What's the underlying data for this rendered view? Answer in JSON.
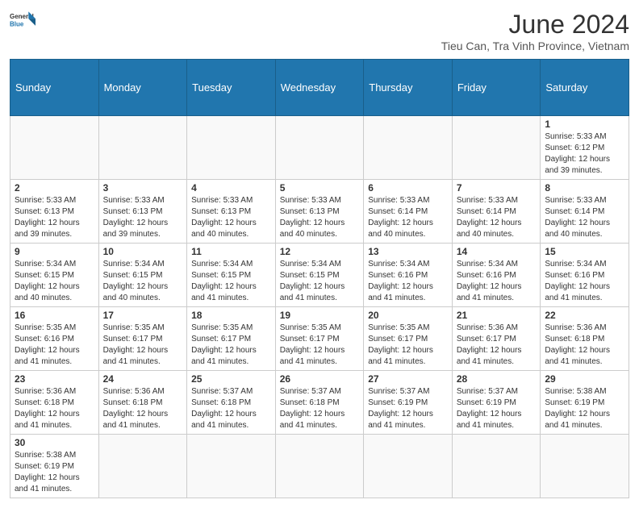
{
  "header": {
    "logo_general": "General",
    "logo_blue": "Blue",
    "month": "June 2024",
    "location": "Tieu Can, Tra Vinh Province, Vietnam"
  },
  "weekdays": [
    "Sunday",
    "Monday",
    "Tuesday",
    "Wednesday",
    "Thursday",
    "Friday",
    "Saturday"
  ],
  "weeks": [
    [
      {
        "day": "",
        "info": ""
      },
      {
        "day": "",
        "info": ""
      },
      {
        "day": "",
        "info": ""
      },
      {
        "day": "",
        "info": ""
      },
      {
        "day": "",
        "info": ""
      },
      {
        "day": "",
        "info": ""
      },
      {
        "day": "1",
        "info": "Sunrise: 5:33 AM\nSunset: 6:12 PM\nDaylight: 12 hours\nand 39 minutes."
      }
    ],
    [
      {
        "day": "2",
        "info": "Sunrise: 5:33 AM\nSunset: 6:13 PM\nDaylight: 12 hours\nand 39 minutes."
      },
      {
        "day": "3",
        "info": "Sunrise: 5:33 AM\nSunset: 6:13 PM\nDaylight: 12 hours\nand 39 minutes."
      },
      {
        "day": "4",
        "info": "Sunrise: 5:33 AM\nSunset: 6:13 PM\nDaylight: 12 hours\nand 40 minutes."
      },
      {
        "day": "5",
        "info": "Sunrise: 5:33 AM\nSunset: 6:13 PM\nDaylight: 12 hours\nand 40 minutes."
      },
      {
        "day": "6",
        "info": "Sunrise: 5:33 AM\nSunset: 6:14 PM\nDaylight: 12 hours\nand 40 minutes."
      },
      {
        "day": "7",
        "info": "Sunrise: 5:33 AM\nSunset: 6:14 PM\nDaylight: 12 hours\nand 40 minutes."
      },
      {
        "day": "8",
        "info": "Sunrise: 5:33 AM\nSunset: 6:14 PM\nDaylight: 12 hours\nand 40 minutes."
      }
    ],
    [
      {
        "day": "9",
        "info": "Sunrise: 5:34 AM\nSunset: 6:15 PM\nDaylight: 12 hours\nand 40 minutes."
      },
      {
        "day": "10",
        "info": "Sunrise: 5:34 AM\nSunset: 6:15 PM\nDaylight: 12 hours\nand 40 minutes."
      },
      {
        "day": "11",
        "info": "Sunrise: 5:34 AM\nSunset: 6:15 PM\nDaylight: 12 hours\nand 41 minutes."
      },
      {
        "day": "12",
        "info": "Sunrise: 5:34 AM\nSunset: 6:15 PM\nDaylight: 12 hours\nand 41 minutes."
      },
      {
        "day": "13",
        "info": "Sunrise: 5:34 AM\nSunset: 6:16 PM\nDaylight: 12 hours\nand 41 minutes."
      },
      {
        "day": "14",
        "info": "Sunrise: 5:34 AM\nSunset: 6:16 PM\nDaylight: 12 hours\nand 41 minutes."
      },
      {
        "day": "15",
        "info": "Sunrise: 5:34 AM\nSunset: 6:16 PM\nDaylight: 12 hours\nand 41 minutes."
      }
    ],
    [
      {
        "day": "16",
        "info": "Sunrise: 5:35 AM\nSunset: 6:16 PM\nDaylight: 12 hours\nand 41 minutes."
      },
      {
        "day": "17",
        "info": "Sunrise: 5:35 AM\nSunset: 6:17 PM\nDaylight: 12 hours\nand 41 minutes."
      },
      {
        "day": "18",
        "info": "Sunrise: 5:35 AM\nSunset: 6:17 PM\nDaylight: 12 hours\nand 41 minutes."
      },
      {
        "day": "19",
        "info": "Sunrise: 5:35 AM\nSunset: 6:17 PM\nDaylight: 12 hours\nand 41 minutes."
      },
      {
        "day": "20",
        "info": "Sunrise: 5:35 AM\nSunset: 6:17 PM\nDaylight: 12 hours\nand 41 minutes."
      },
      {
        "day": "21",
        "info": "Sunrise: 5:36 AM\nSunset: 6:17 PM\nDaylight: 12 hours\nand 41 minutes."
      },
      {
        "day": "22",
        "info": "Sunrise: 5:36 AM\nSunset: 6:18 PM\nDaylight: 12 hours\nand 41 minutes."
      }
    ],
    [
      {
        "day": "23",
        "info": "Sunrise: 5:36 AM\nSunset: 6:18 PM\nDaylight: 12 hours\nand 41 minutes."
      },
      {
        "day": "24",
        "info": "Sunrise: 5:36 AM\nSunset: 6:18 PM\nDaylight: 12 hours\nand 41 minutes."
      },
      {
        "day": "25",
        "info": "Sunrise: 5:37 AM\nSunset: 6:18 PM\nDaylight: 12 hours\nand 41 minutes."
      },
      {
        "day": "26",
        "info": "Sunrise: 5:37 AM\nSunset: 6:18 PM\nDaylight: 12 hours\nand 41 minutes."
      },
      {
        "day": "27",
        "info": "Sunrise: 5:37 AM\nSunset: 6:19 PM\nDaylight: 12 hours\nand 41 minutes."
      },
      {
        "day": "28",
        "info": "Sunrise: 5:37 AM\nSunset: 6:19 PM\nDaylight: 12 hours\nand 41 minutes."
      },
      {
        "day": "29",
        "info": "Sunrise: 5:38 AM\nSunset: 6:19 PM\nDaylight: 12 hours\nand 41 minutes."
      }
    ],
    [
      {
        "day": "30",
        "info": "Sunrise: 5:38 AM\nSunset: 6:19 PM\nDaylight: 12 hours\nand 41 minutes."
      },
      {
        "day": "",
        "info": ""
      },
      {
        "day": "",
        "info": ""
      },
      {
        "day": "",
        "info": ""
      },
      {
        "day": "",
        "info": ""
      },
      {
        "day": "",
        "info": ""
      },
      {
        "day": "",
        "info": ""
      }
    ]
  ]
}
